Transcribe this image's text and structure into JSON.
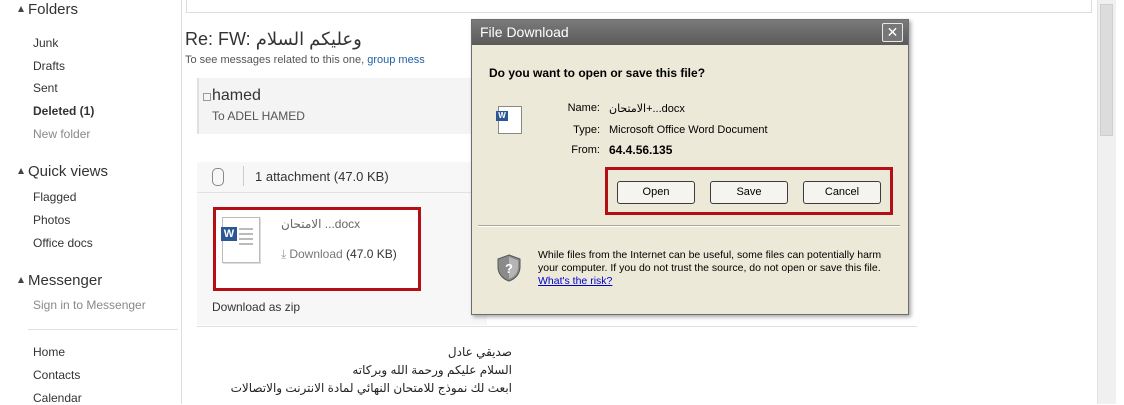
{
  "sidebar": {
    "folders_header": "Folders",
    "folders": [
      {
        "label": "Junk"
      },
      {
        "label": "Drafts"
      },
      {
        "label": "Sent"
      },
      {
        "label": "Deleted (1)"
      },
      {
        "label": "New folder"
      }
    ],
    "quick_views_header": "Quick views",
    "quick_views": [
      {
        "label": "Flagged"
      },
      {
        "label": "Photos"
      },
      {
        "label": "Office docs"
      }
    ],
    "messenger_header": "Messenger",
    "messenger_signin": "Sign in to Messenger",
    "bottom_links": [
      {
        "label": "Home"
      },
      {
        "label": "Contacts"
      },
      {
        "label": "Calendar"
      }
    ]
  },
  "message": {
    "subject": "Re: FW: وعليكم السلام",
    "related_prefix": "To see messages related to this one,",
    "related_link": "group mess",
    "sender_name": "hamed",
    "sender_to": "To ADEL HAMED",
    "attachment_count": "1 attachment (47.0 KB)",
    "file_name": "الامتحان ...docx",
    "download_label": "Download",
    "download_size": "(47.0 KB)",
    "download_zip": "Download as zip",
    "body_lines": [
      "صديقي عادل",
      "السلام عليكم ورحمة الله وبركاته",
      "ابعث لك نموذج للامتحان النهائي لمادة الانترنت والاتصالات"
    ]
  },
  "dialog": {
    "title": "File Download",
    "close_glyph": "✕",
    "question": "Do you want to open or save this file?",
    "name_label": "Name:",
    "name_value": "الامتحان+...docx",
    "type_label": "Type:",
    "type_value": "Microsoft Office Word Document",
    "from_label": "From:",
    "from_value": "64.4.56.135",
    "open_button": "Open",
    "save_button": "Save",
    "cancel_button": "Cancel",
    "warning_text": "While files from the Internet can be useful, some files can potentially harm your computer. If you do not trust the source, do not open or save this file.",
    "risk_link": "What's the risk?"
  },
  "colors": {
    "highlight_red": "#b40f14",
    "dialog_bg": "#ece9d8",
    "title_bar": "#6a6a6a",
    "link_blue": "#1f5fa8"
  },
  "icons": {
    "paperclip": "paperclip-icon",
    "word_doc": "word-document-icon",
    "download_arrow": "download-arrow-icon",
    "shield": "security-shield-icon",
    "close": "close-icon"
  }
}
